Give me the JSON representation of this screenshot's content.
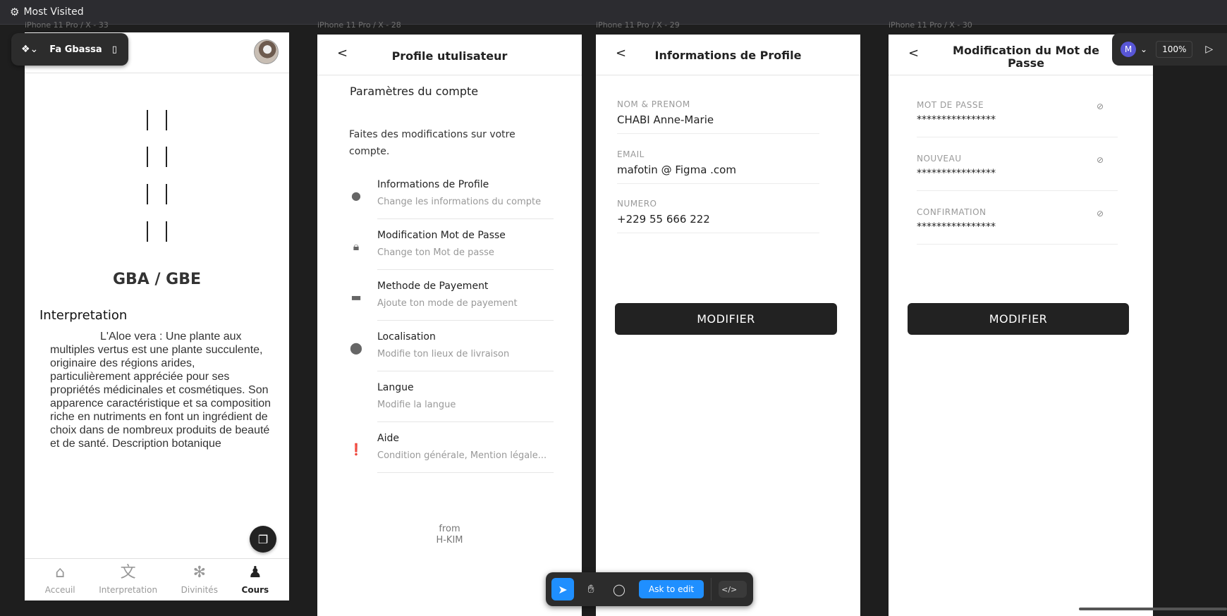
{
  "browser": {
    "bookmark": "Most Visited"
  },
  "frames": {
    "f1": "iPhone 11 Pro / X - 33",
    "f2": "iPhone 11 Pro / X - 28",
    "f3": "iPhone 11 Pro / X - 29",
    "f4": "iPhone 11 Pro / X - 30"
  },
  "plugin": {
    "name": "Fa Gbassa"
  },
  "screen1": {
    "title": "GBA / GBE",
    "subtitle": "Interpretation",
    "body": "L'Aloe vera : Une plante aux multiples vertus est une plante succulente, originaire des régions arides, particulièrement appréciée pour ses propriétés médicinales et cosmétiques. Son apparence caractéristique et sa composition riche en nutriments en font un ingrédient de choix dans de nombreux produits de beauté et de santé. Description botanique",
    "tabs": [
      {
        "label": "Acceuil",
        "icon": "home-icon"
      },
      {
        "label": "Interpretation",
        "icon": "translate-icon"
      },
      {
        "label": "Divinités",
        "icon": "snowflake-icon"
      },
      {
        "label": "Cours",
        "icon": "hiking-icon"
      }
    ],
    "active_tab": "Cours"
  },
  "screen2": {
    "back": "<",
    "title": "Profile  utulisateur",
    "section": "Paramètres du compte",
    "description": "Faites des modifications sur votre compte.",
    "items": [
      {
        "title": "Informations de Profile",
        "subtitle": "Change les informations du compte",
        "icon": "person-icon"
      },
      {
        "title": "Modification Mot de Passe",
        "subtitle": "Change ton Mot de passe",
        "icon": "lock-icon"
      },
      {
        "title": "Methode de Payement",
        "subtitle": "Ajoute ton mode de payement",
        "icon": "card-icon"
      },
      {
        "title": "Localisation",
        "subtitle": "Modifie ton lieux de livraison",
        "icon": "location-icon"
      },
      {
        "title": "Langue",
        "subtitle": "Modifie la langue",
        "icon": ""
      },
      {
        "title": "Aide",
        "subtitle": "Condition générale, Mention légale...",
        "icon": "alert-icon"
      }
    ],
    "from_line1": "from",
    "from_line2": "H-KIM"
  },
  "screen3": {
    "back": "<",
    "title": "Informations de Profile",
    "fields": [
      {
        "label": "NOM & PRENOM",
        "value": "CHABI Anne-Marie"
      },
      {
        "label": "EMAIL",
        "value": "mafotin @ Figma .com"
      },
      {
        "label": "NUMERO",
        "value": "+229 55 666 222"
      }
    ],
    "button": "MODIFIER"
  },
  "screen4": {
    "back": "<",
    "title": "Modification du  Mot de Passe",
    "fields": [
      {
        "label": "MOT DE PASSE",
        "value": "****************"
      },
      {
        "label": "NOUVEAU",
        "value": "****************"
      },
      {
        "label": "CONFIRMATION",
        "value": "****************"
      }
    ],
    "button": "MODIFIER"
  },
  "zoom": {
    "user_initial": "M",
    "level": "100%"
  },
  "toolbar": {
    "ask": "Ask to edit"
  },
  "colors": {
    "accent": "#1f8fff",
    "dark_button": "#222222",
    "canvas": "#1e1e1e"
  }
}
